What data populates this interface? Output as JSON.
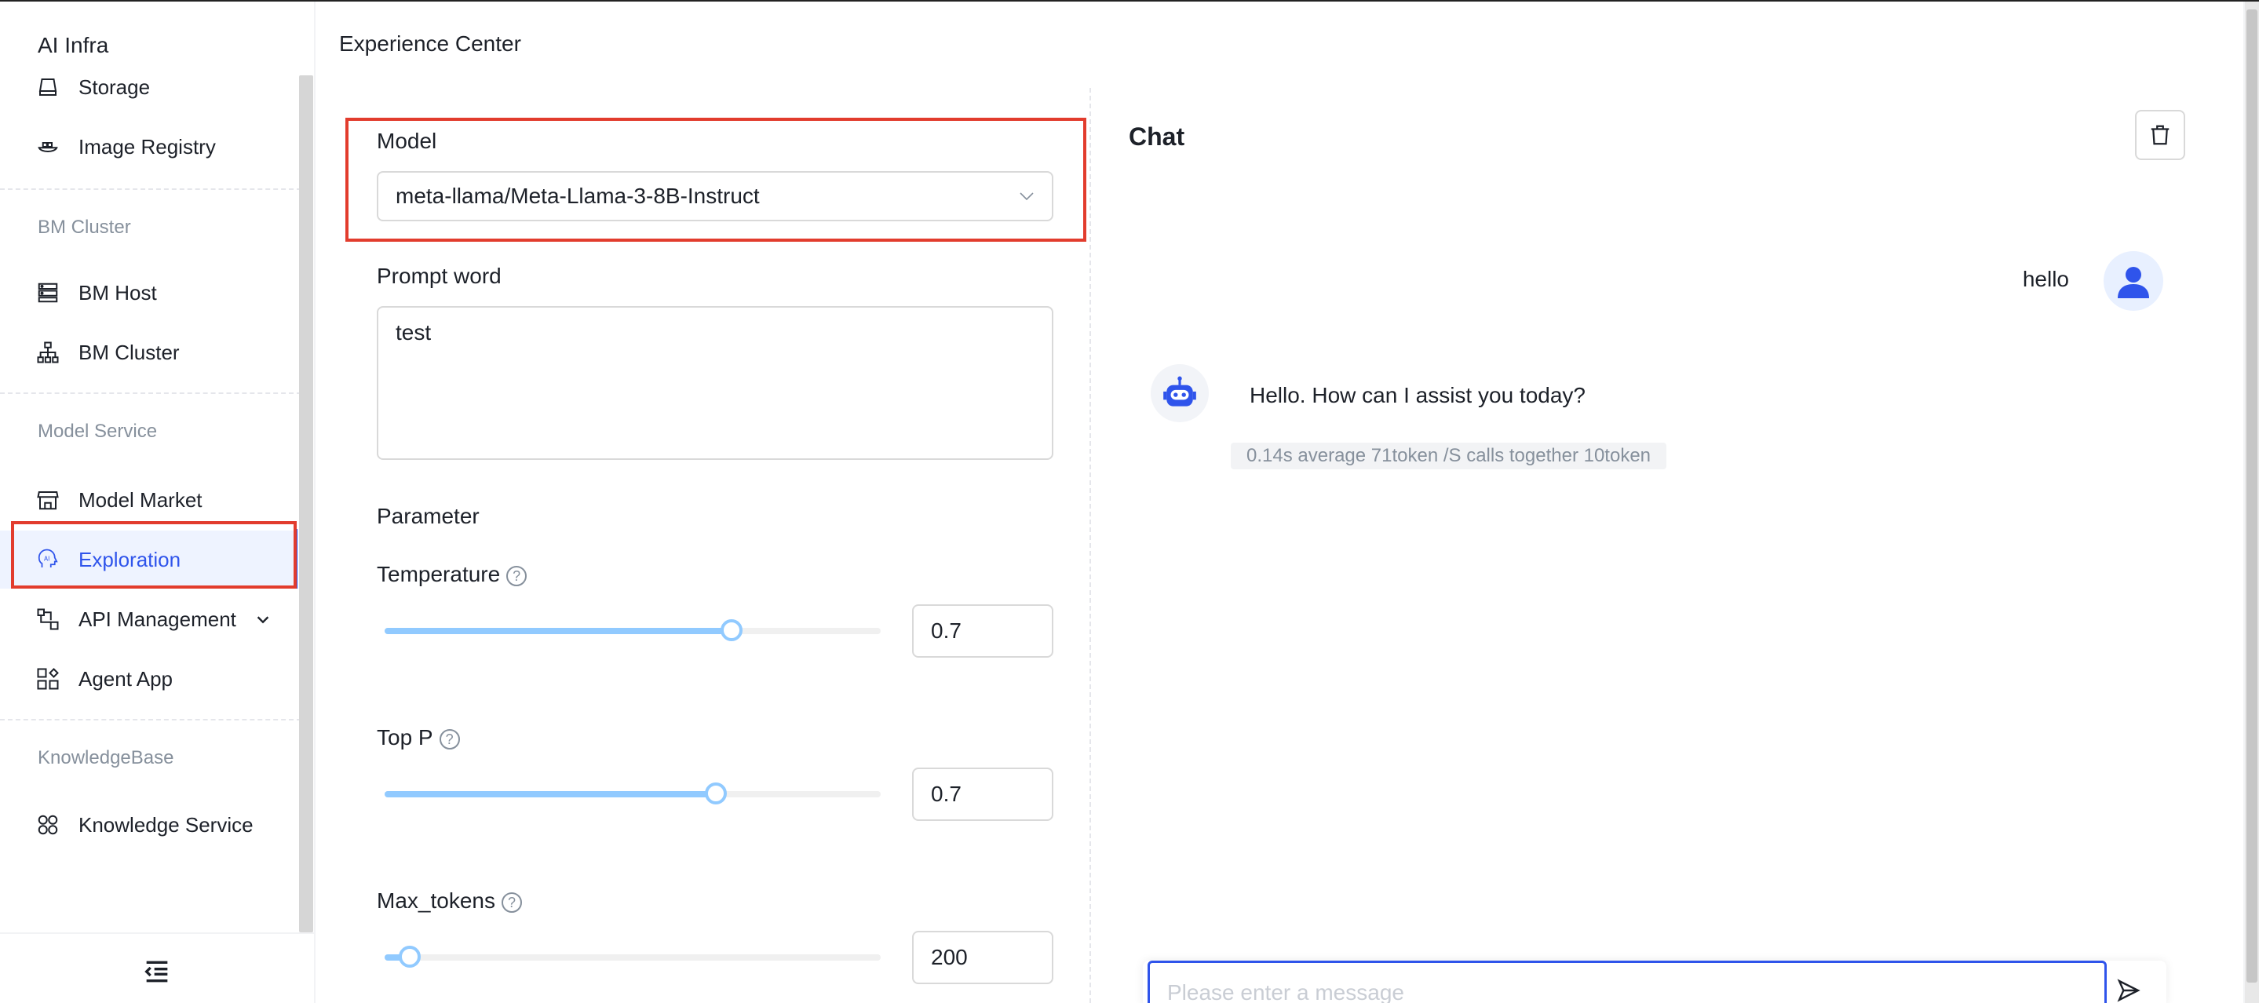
{
  "sidebar": {
    "app_title": "AI Infra",
    "items_top": [
      {
        "label": "Storage",
        "icon": "storage-icon"
      },
      {
        "label": "Image Registry",
        "icon": "image-registry-icon"
      }
    ],
    "group_bm": "BM Cluster",
    "items_bm": [
      {
        "label": "BM Host",
        "icon": "server-icon"
      },
      {
        "label": "BM Cluster",
        "icon": "cluster-icon"
      }
    ],
    "group_model": "Model Service",
    "items_model": [
      {
        "label": "Model Market",
        "icon": "store-icon"
      },
      {
        "label": "Exploration",
        "icon": "ai-head-icon",
        "active": true
      },
      {
        "label": "API Management",
        "icon": "api-icon",
        "expandable": true
      },
      {
        "label": "Agent App",
        "icon": "apps-icon"
      }
    ],
    "group_kb": "KnowledgeBase",
    "items_kb": [
      {
        "label": "Knowledge Service",
        "icon": "knowledge-icon"
      }
    ]
  },
  "main": {
    "page_title": "Experience Center",
    "model": {
      "label": "Model",
      "value": "meta-llama/Meta-Llama-3-8B-Instruct"
    },
    "prompt": {
      "label": "Prompt word",
      "value": "test"
    },
    "parameter_title": "Parameter",
    "params": [
      {
        "label": "Temperature",
        "value": "0.7",
        "fraction": 0.7
      },
      {
        "label": "Top P",
        "value": "0.7",
        "fraction": 0.667
      },
      {
        "label": "Max_tokens",
        "value": "200",
        "fraction": 0.05
      }
    ]
  },
  "chat": {
    "title": "Chat",
    "user_message": "hello",
    "bot_message": "Hello. How can I assist you today?",
    "stats": "0.14s average 71token /S calls together 10token",
    "input_placeholder": "Please enter a message"
  },
  "colors": {
    "accent": "#2f54eb",
    "highlight": "#e23c2d",
    "slider": "#91caff"
  }
}
